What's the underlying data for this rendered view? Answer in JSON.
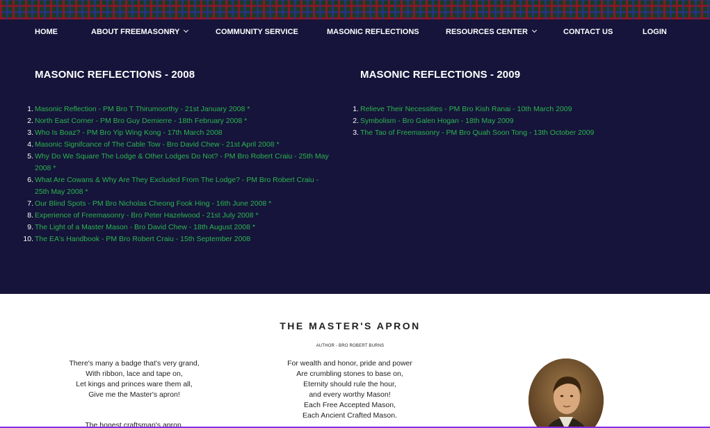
{
  "nav": {
    "items": [
      {
        "label": "HOME",
        "dropdown": false
      },
      {
        "label": "ABOUT FREEMASONRY",
        "dropdown": true
      },
      {
        "label": "COMMUNITY SERVICE",
        "dropdown": false
      },
      {
        "label": "MASONIC REFLECTIONS",
        "dropdown": false
      },
      {
        "label": "RESOURCES CENTER",
        "dropdown": true
      },
      {
        "label": "CONTACT US",
        "dropdown": false
      },
      {
        "label": "LOGIN",
        "dropdown": false
      }
    ]
  },
  "reflections": {
    "col2008": {
      "title": "MASONIC REFLECTIONS - 2008",
      "items": [
        "Masonic Reflection - PM Bro T Thirumoorthy - 21st January 2008 *",
        "North East Corner - PM Bro Guy Demierre - 18th February 2008 *",
        "Who Is Boaz? - PM Bro Yip Wing Kong - 17th March 2008",
        "Masonic Signifcance of The Cable Tow - Bro David Chew - 21st April 2008 *",
        "Why Do We Square The Lodge & Other Lodges Do Not? - PM Bro Robert Craiu - 25th May 2008 *",
        "What Are Cowans & Why Are They Excluded From The Lodge? - PM Bro Robert Craiu - 25th May 2008 *",
        "Our Blind Spots - PM Bro Nicholas Cheong Fook Hing - 16th June 2008 *",
        "Experience of Freemasonry - Bro Peter Hazelwood - 21st July 2008 *",
        "The Light of a Master Mason - Bro David Chew - 18th August 2008 *",
        "The EA's Handbook - PM Bro Robert Craiu - 15th September 2008"
      ]
    },
    "col2009": {
      "title": "MASONIC REFLECTIONS - 2009",
      "items": [
        "Relieve Their Necessities - PM Bro Kish Ranai - 10th March 2009",
        "Symbolism - Bro Galen Hogan - 18th May 2009",
        "The Tao of Freemasonry - PM Bro Quah Soon Tong - 13th October 2009"
      ]
    }
  },
  "apron": {
    "title": "THE MASTER'S APRON",
    "author": "AUTHOR - BRO ROBERT BURNS",
    "verse1": [
      "There's many a badge that's very grand,",
      "With ribbon, lace and tape on,",
      "Let kings and princes ware them all,",
      "Give me the Master's apron!"
    ],
    "verse1b": [
      "The honest craftsman's apron,"
    ],
    "verse2": [
      "For wealth and honor, pride and power",
      "Are crumbling stones to base on,",
      "Eternity should rule the hour,",
      "and every worthy Mason!",
      "Each Free Accepted Mason,",
      "Each Ancient Crafted Mason."
    ],
    "portrait_icon": "robert-burns-portrait"
  },
  "colors": {
    "dark_bg": "#16143a",
    "link_green": "#2bb54f",
    "accent_line": "#8a2be2"
  }
}
